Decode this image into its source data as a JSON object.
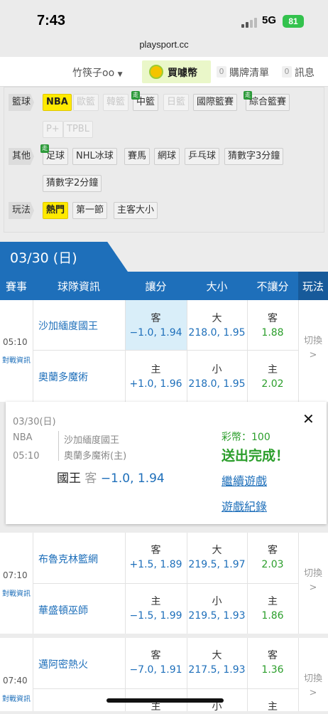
{
  "status": {
    "time": "7:43",
    "network": "5G",
    "battery": "81",
    "url": "playsport.cc"
  },
  "header": {
    "user": "竹筷子oo",
    "buy": "買噱幣",
    "cart_count": "0",
    "cart": "購牌清單",
    "msg_count": "0",
    "msg": "訊息"
  },
  "filter": {
    "cat1": "籃球",
    "cat2": "其他",
    "cat3": "玩法",
    "bball": [
      "NBA",
      "歐籃",
      "韓籃",
      "中籃",
      "日籃",
      "國際籃賽",
      "綜合籃賽",
      "P+",
      "TPBL"
    ],
    "other": [
      "足球",
      "NHL冰球",
      "賽馬",
      "網球",
      "乒乓球",
      "猜數字3分鐘",
      "猜數字2分鐘"
    ],
    "play": [
      "熱門",
      "第一節",
      "主客大小"
    ],
    "walk": "走"
  },
  "date": "03/30 (日)",
  "columns": {
    "event": "賽事",
    "team": "球隊資訊",
    "spread": "讓分",
    "total": "大小",
    "ml": "不讓分",
    "play": "玩法"
  },
  "common": {
    "away": "客",
    "home": "主",
    "over": "大",
    "under": "小",
    "switch": "切換",
    "chev": ">",
    "vs": "對戰資訊"
  },
  "games": [
    {
      "time": "05:10",
      "away": "沙加緬度國王",
      "home": "奧蘭多魔術",
      "a_spread": "−1.0, 1.94",
      "h_spread": "+1.0, 1.96",
      "o_total": "218.0, 1.95",
      "u_total": "218.0, 1.95",
      "a_ml": "1.88",
      "h_ml": "2.02"
    },
    {
      "time": "07:10",
      "away": "布魯克林籃網",
      "home": "華盛頓巫師",
      "a_spread": "+1.5, 1.89",
      "h_spread": "−1.5, 1.99",
      "o_total": "219.5, 1.97",
      "u_total": "219.5, 1.93",
      "a_ml": "2.03",
      "h_ml": "1.86"
    },
    {
      "time": "07:40",
      "away": "邁阿密熱火",
      "home": "",
      "a_spread": "−7.0, 1.91",
      "o_total": "217.5, 1.93",
      "a_ml": "1.36"
    }
  ],
  "popup": {
    "date": "03/30(日)",
    "league": "NBA",
    "time": "05:10",
    "team1": "沙加緬度國王",
    "team2": "奧蘭多魔術(主)",
    "pick_team": "國王",
    "pick_side": "客",
    "pick_odds": "−1.0, 1.94",
    "coin": "彩幣：100",
    "done": "送出完成！",
    "continue": "繼續遊戲",
    "record": "遊戲紀錄",
    "close": "✕"
  },
  "colors": {
    "blue": "#1e6fba",
    "green": "#2b9e2b",
    "yellow": "#ffea00"
  }
}
